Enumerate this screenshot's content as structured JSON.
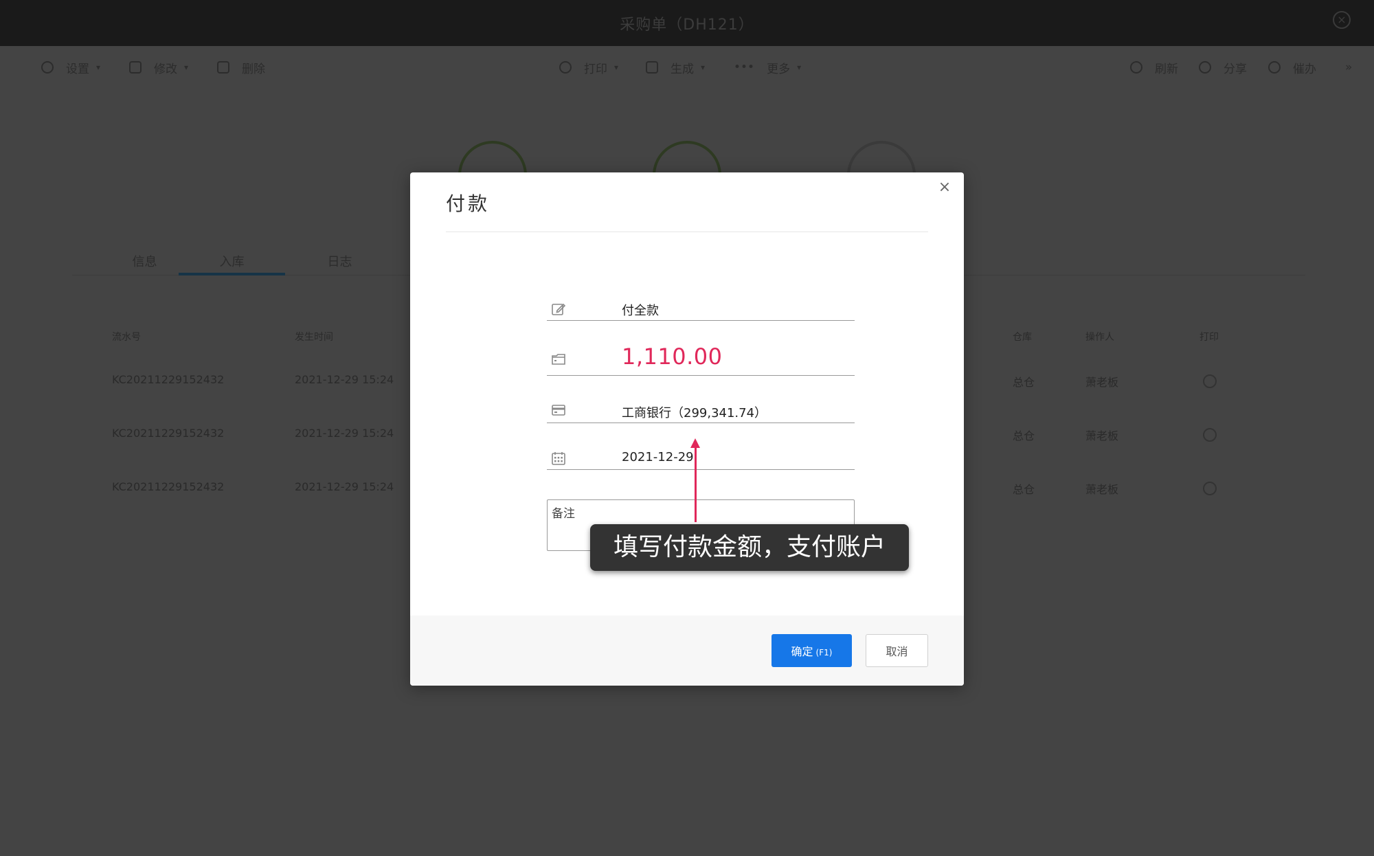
{
  "window": {
    "title": "采购单（DH121）"
  },
  "toolbar": {
    "settings": "设置",
    "edit": "修改",
    "delete": "删除",
    "print": "打印",
    "generate": "生成",
    "more": "更多",
    "refresh": "刷新",
    "share": "分享",
    "todo": "催办"
  },
  "tabs": [
    "信息",
    "入库",
    "日志"
  ],
  "table": {
    "headers": [
      "流水号",
      "发生时间",
      "仓库",
      "操作人",
      "打印"
    ],
    "rows": [
      {
        "serial": "KC20211229152432",
        "time": "2021-12-29 15:24",
        "warehouse": "总仓",
        "operator": "萧老板"
      },
      {
        "serial": "KC20211229152432",
        "time": "2021-12-29 15:24",
        "warehouse": "总仓",
        "operator": "萧老板"
      },
      {
        "serial": "KC20211229152432",
        "time": "2021-12-29 15:24",
        "warehouse": "总仓",
        "operator": "萧老板"
      }
    ]
  },
  "modal": {
    "title": "付款",
    "close": "×",
    "payment_type": "付全款",
    "amount": "1,110.00",
    "account": "工商银行（299,341.74）",
    "date": "2021-12-29",
    "remark_placeholder": "备注",
    "ok_label": "确定",
    "ok_key": "(F1)",
    "cancel_label": "取消"
  },
  "tutorial": {
    "callout": "填写付款金额，支付账户"
  },
  "colors": {
    "accent": "#1677e8",
    "amount": "#e0285a",
    "overlay": "#444444",
    "titlebar": "#1a1a1a"
  },
  "icons": {
    "payment_type": "edit-icon",
    "amount": "wallet-icon",
    "account": "credit-card-icon",
    "date": "calendar-icon",
    "close": "close-icon"
  }
}
